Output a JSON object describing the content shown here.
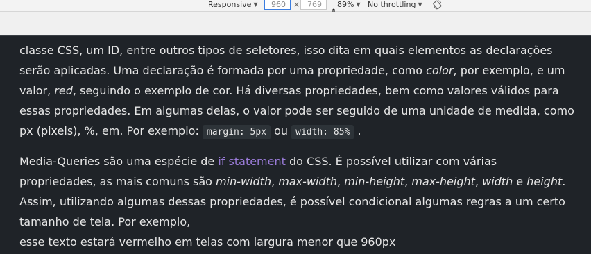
{
  "devtools": {
    "device": "Responsive",
    "width": "960",
    "separator": "×",
    "height": "769",
    "zoom": "89%",
    "throttling": "No throttling"
  },
  "article": {
    "p1": {
      "t1": "classe CSS, um ID, entre outros tipos de seletores, isso dita em quais elementos as declarações serão aplicadas. Uma declaração é formada por uma propriedade, como ",
      "em1": "color",
      "t2": ", por exemplo, e um valor, ",
      "em2": "red",
      "t3": ", seguindo o exemplo de cor. Há diversas propriedades, bem como valores válidos para essas propriedades. Em algumas delas, o valor pode ser seguido de uma unidade de medida, como px (pixels), %, em. Por exemplo: ",
      "code1": "margin: 5px",
      "t4": " ou ",
      "code2": "width: 85%",
      "t5": " ."
    },
    "p2": {
      "t1": "Media-Queries são uma espécie de ",
      "link": "if statement",
      "t2": " do CSS. É possível utilizar com várias propriedades, as mais comuns são ",
      "em1": "min-width",
      "t3": ", ",
      "em2": "max-width",
      "t4": ", ",
      "em3": "min-height",
      "t5": ", ",
      "em4": "max-height",
      "t6": ", ",
      "em5": "width",
      "t7": " e ",
      "em6": "height",
      "t8": ". Assim, utilizando algumas dessas propriedades, é possível condicional algumas regras a um certo tamanho de tela. Por exemplo,",
      "line2": "esse texto estará vermelho em telas com largura menor que 960px"
    }
  }
}
